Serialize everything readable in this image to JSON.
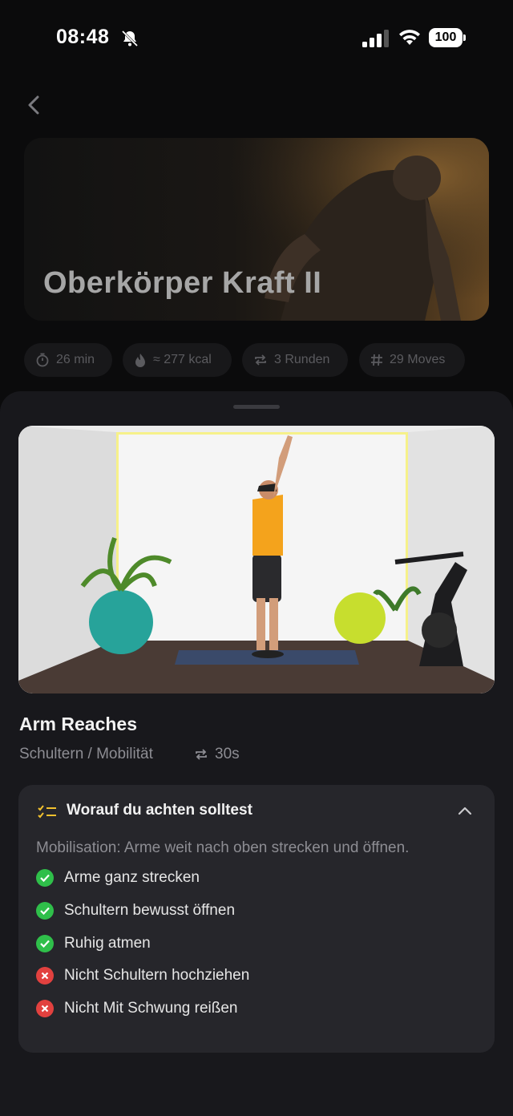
{
  "status_bar": {
    "time": "08:48",
    "battery": "100"
  },
  "workout": {
    "title": "Oberkörper Kraft II"
  },
  "chips": [
    {
      "label": "26 min",
      "icon": "timer-icon"
    },
    {
      "label": "≈ 277 kcal",
      "icon": "flame-icon"
    },
    {
      "label": "3 Runden",
      "icon": "repeat-icon"
    },
    {
      "label": "29 Moves",
      "icon": "hash-icon"
    }
  ],
  "exercise": {
    "name": "Arm Reaches",
    "category": "Schultern / Mobilität",
    "duration": "30s"
  },
  "tips": {
    "title": "Worauf du achten solltest",
    "description": "Mobilisation: Arme weit nach oben strecken und öffnen.",
    "items": [
      {
        "label": "Arme ganz strecken",
        "type": "do"
      },
      {
        "label": "Schultern bewusst öffnen",
        "type": "do"
      },
      {
        "label": "Ruhig atmen",
        "type": "do"
      },
      {
        "label": "Nicht Schultern hochziehen",
        "type": "dont"
      },
      {
        "label": "Nicht Mit Schwung reißen",
        "type": "dont"
      }
    ]
  },
  "colors": {
    "do": "#2fbf4a",
    "dont": "#e2413f",
    "accent": "#f2c12e"
  }
}
